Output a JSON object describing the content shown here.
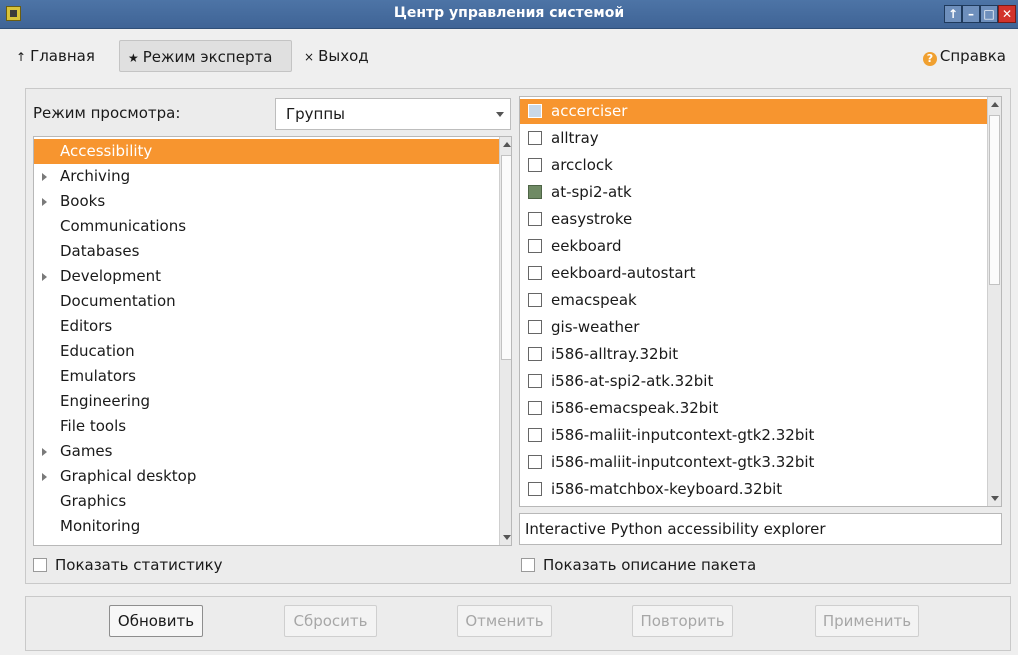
{
  "window": {
    "title": "Центр управления системой",
    "controls": [
      "↑",
      "–",
      "□",
      "✕"
    ]
  },
  "tabs": [
    {
      "glyph": "↑",
      "label": "Главная"
    },
    {
      "glyph": "★",
      "label": "Режим эксперта"
    },
    {
      "glyph": "×",
      "label": "Выход"
    }
  ],
  "help": {
    "label": "Справка",
    "glyph": "?"
  },
  "view_mode": {
    "label": "Режим просмотра:",
    "value": "Группы"
  },
  "groups": [
    {
      "label": "Accessibility",
      "expandable": false,
      "selected": true
    },
    {
      "label": "Archiving",
      "expandable": true,
      "selected": false
    },
    {
      "label": "Books",
      "expandable": true,
      "selected": false
    },
    {
      "label": "Communications",
      "expandable": false,
      "selected": false
    },
    {
      "label": "Databases",
      "expandable": false,
      "selected": false
    },
    {
      "label": "Development",
      "expandable": true,
      "selected": false
    },
    {
      "label": "Documentation",
      "expandable": false,
      "selected": false
    },
    {
      "label": "Editors",
      "expandable": false,
      "selected": false
    },
    {
      "label": "Education",
      "expandable": false,
      "selected": false
    },
    {
      "label": "Emulators",
      "expandable": false,
      "selected": false
    },
    {
      "label": "Engineering",
      "expandable": false,
      "selected": false
    },
    {
      "label": "File tools",
      "expandable": false,
      "selected": false
    },
    {
      "label": "Games",
      "expandable": true,
      "selected": false
    },
    {
      "label": "Graphical desktop",
      "expandable": true,
      "selected": false
    },
    {
      "label": "Graphics",
      "expandable": false,
      "selected": false
    },
    {
      "label": "Monitoring",
      "expandable": false,
      "selected": false
    }
  ],
  "packages": [
    {
      "name": "accerciser",
      "installed": false,
      "selected": true
    },
    {
      "name": "alltray",
      "installed": false,
      "selected": false
    },
    {
      "name": "arcclock",
      "installed": false,
      "selected": false
    },
    {
      "name": "at-spi2-atk",
      "installed": true,
      "selected": false
    },
    {
      "name": "easystroke",
      "installed": false,
      "selected": false
    },
    {
      "name": "eekboard",
      "installed": false,
      "selected": false
    },
    {
      "name": "eekboard-autostart",
      "installed": false,
      "selected": false
    },
    {
      "name": "emacspeak",
      "installed": false,
      "selected": false
    },
    {
      "name": "gis-weather",
      "installed": false,
      "selected": false
    },
    {
      "name": "i586-alltray.32bit",
      "installed": false,
      "selected": false
    },
    {
      "name": "i586-at-spi2-atk.32bit",
      "installed": false,
      "selected": false
    },
    {
      "name": "i586-emacspeak.32bit",
      "installed": false,
      "selected": false
    },
    {
      "name": "i586-maliit-inputcontext-gtk2.32bit",
      "installed": false,
      "selected": false
    },
    {
      "name": "i586-maliit-inputcontext-gtk3.32bit",
      "installed": false,
      "selected": false
    },
    {
      "name": "i586-matchbox-keyboard.32bit",
      "installed": false,
      "selected": false
    }
  ],
  "description": "Interactive Python accessibility explorer",
  "options": {
    "show_stats": "Показать статистику",
    "show_description": "Показать описание пакета"
  },
  "buttons": [
    {
      "label": "Обновить",
      "enabled": true
    },
    {
      "label": "Сбросить",
      "enabled": false
    },
    {
      "label": "Отменить",
      "enabled": false
    },
    {
      "label": "Повторить",
      "enabled": false
    },
    {
      "label": "Применить",
      "enabled": false
    }
  ],
  "colors": {
    "selection": "#f7952f",
    "titlebar": "#4d74a6",
    "installed_check": "#6f8a64"
  }
}
